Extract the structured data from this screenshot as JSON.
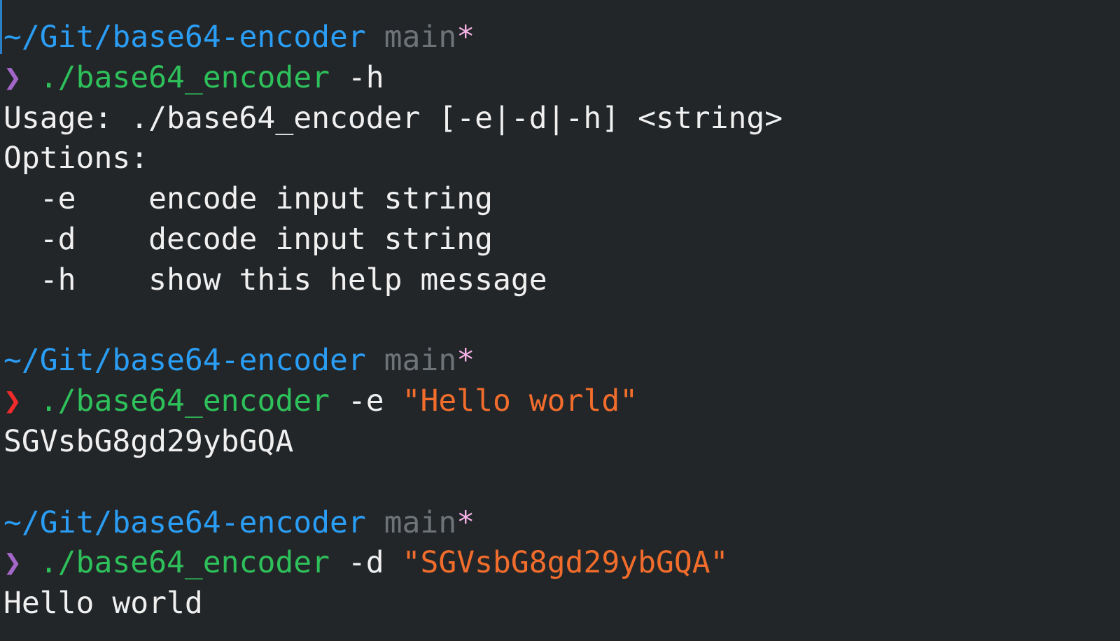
{
  "prompt": {
    "path": "~/Git/base64-encoder",
    "branch": "main",
    "dirty_marker": "*",
    "arrow": "❯"
  },
  "blocks": [
    {
      "command": "./base64_encoder",
      "flag": "-h",
      "argument": "",
      "exit_status": "ok",
      "output": [
        "Usage: ./base64_encoder [-e|-d|-h] <string>",
        "Options:",
        "  -e    encode input string",
        "  -d    decode input string",
        "  -h    show this help message"
      ]
    },
    {
      "command": "./base64_encoder",
      "flag": "-e",
      "argument": "\"Hello world\"",
      "exit_status": "error",
      "output": [
        "SGVsbG8gd29ybGQA"
      ]
    },
    {
      "command": "./base64_encoder",
      "flag": "-d",
      "argument": "\"SGVsbG8gd29ybGQA\"",
      "exit_status": "ok",
      "output": [
        "Hello world"
      ]
    }
  ],
  "colors": {
    "background": "#232629",
    "path": "#2a9df4",
    "branch": "#6e7378",
    "dirty_marker": "#f7b2e6",
    "arrow_ok": "#a366c9",
    "arrow_error": "#f02b2b",
    "command": "#2ec05a",
    "string_argument": "#f26d2c",
    "output_text": "#f0f0f0"
  }
}
